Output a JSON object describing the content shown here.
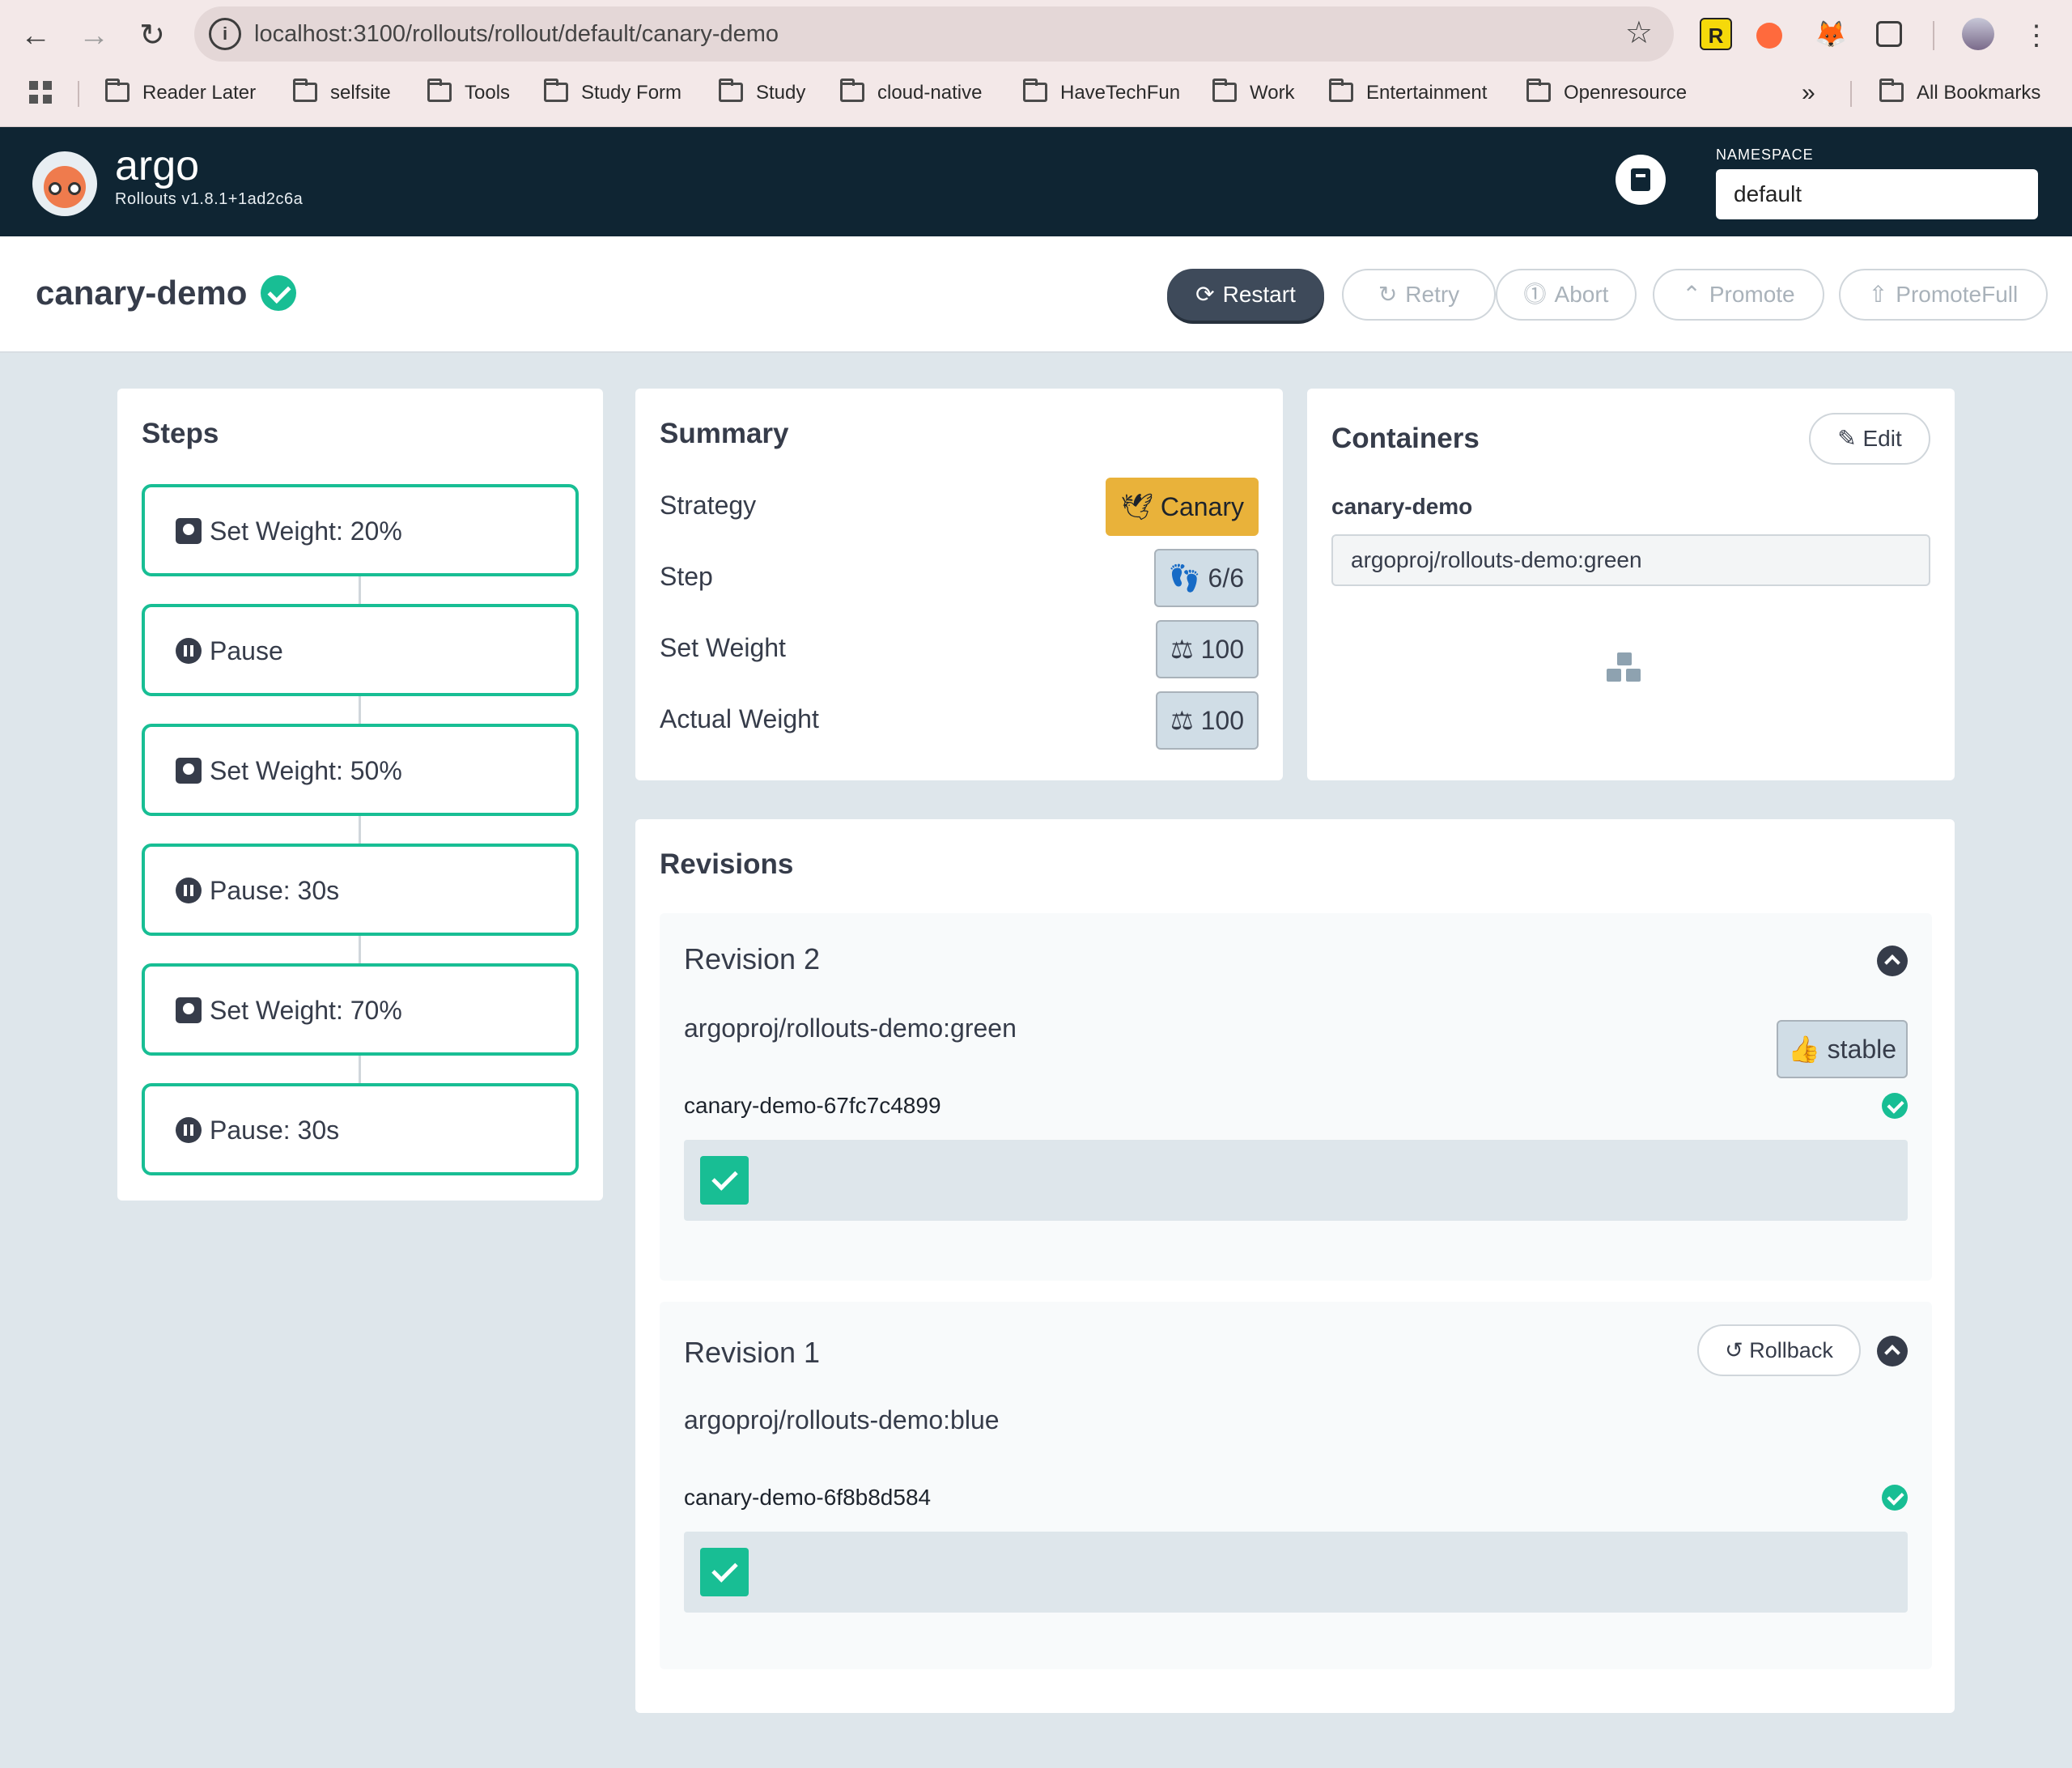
{
  "browser": {
    "url": "localhost:3100/rollouts/rollout/default/canary-demo",
    "bookmarks": [
      "Reader Later",
      "selfsite",
      "Tools",
      "Study Form",
      "Study",
      "cloud-native",
      "HaveTechFun",
      "Work",
      "Entertainment",
      "Openresource"
    ],
    "all_bookmarks": "All Bookmarks",
    "more": "»"
  },
  "header": {
    "brand": "argo",
    "version": "Rollouts v1.8.1+1ad2c6a",
    "namespace_label": "NAMESPACE",
    "namespace_value": "default"
  },
  "rollout": {
    "name": "canary-demo",
    "actions": {
      "restart": "Restart",
      "retry": "Retry",
      "abort": "Abort",
      "promote": "Promote",
      "promote_full": "PromoteFull"
    }
  },
  "steps": {
    "title": "Steps",
    "items": [
      {
        "label": "Set Weight: 20%",
        "icon": "weight-icon"
      },
      {
        "label": "Pause",
        "icon": "pause-icon"
      },
      {
        "label": "Set Weight: 50%",
        "icon": "weight-icon"
      },
      {
        "label": "Pause: 30s",
        "icon": "pause-icon"
      },
      {
        "label": "Set Weight: 70%",
        "icon": "weight-icon"
      },
      {
        "label": "Pause: 30s",
        "icon": "pause-icon"
      }
    ]
  },
  "summary": {
    "title": "Summary",
    "rows": [
      {
        "label": "Strategy",
        "value": "Canary"
      },
      {
        "label": "Step",
        "value": "6/6"
      },
      {
        "label": "Set Weight",
        "value": "100"
      },
      {
        "label": "Actual Weight",
        "value": "100"
      }
    ]
  },
  "containers": {
    "title": "Containers",
    "edit": "Edit",
    "name": "canary-demo",
    "image": "argoproj/rollouts-demo:green"
  },
  "revisions": {
    "title": "Revisions",
    "items": [
      {
        "title": "Revision 2",
        "image": "argoproj/rollouts-demo:green",
        "badge": "stable",
        "replicaset": "canary-demo-67fc7c4899"
      },
      {
        "title": "Revision 1",
        "image": "argoproj/rollouts-demo:blue",
        "rollback": "Rollback",
        "replicaset": "canary-demo-6f8b8d584"
      }
    ]
  },
  "colors": {
    "healthy": "#18be94",
    "canary": "#e9b23a",
    "header_bg": "#0f2533"
  }
}
